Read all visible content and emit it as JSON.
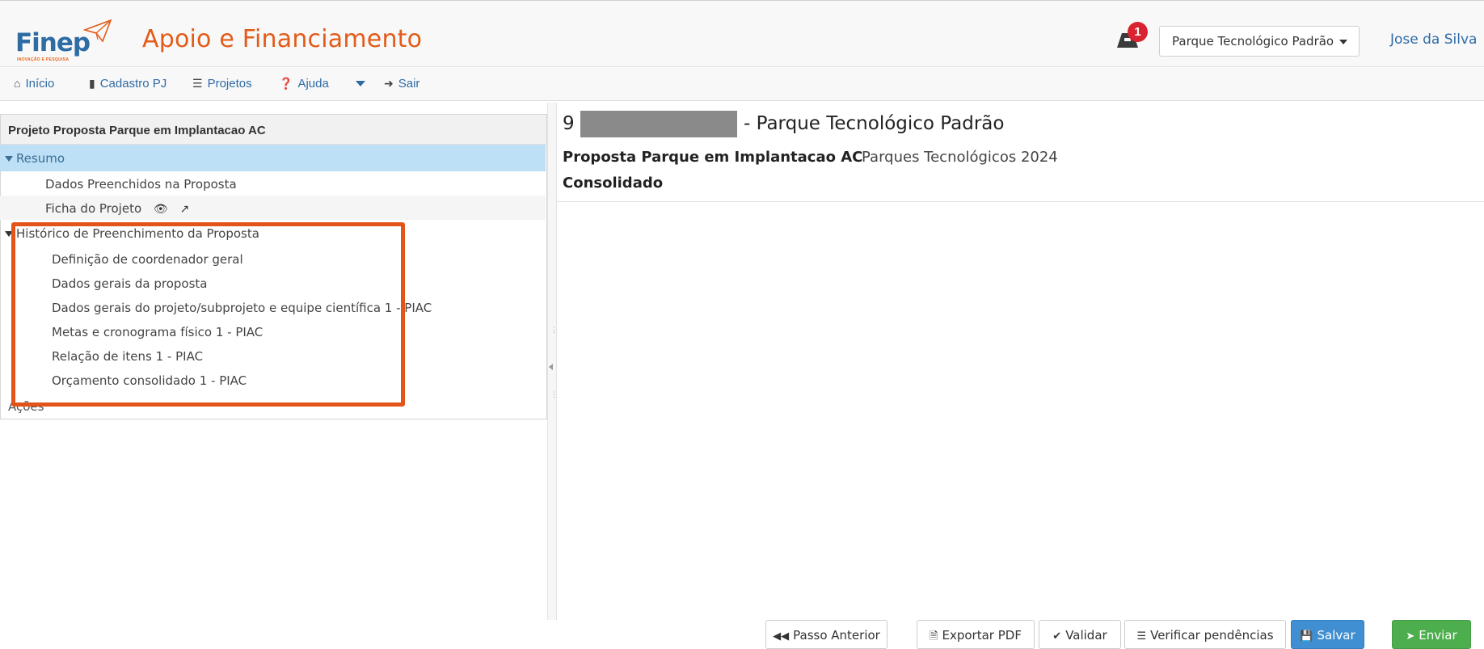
{
  "header": {
    "logo_text": "Finep",
    "logo_sub": "INOVAÇÃO E PESQUISA",
    "app_title": "Apoio e Financiamento",
    "notification_count": "1",
    "parque_selector": "Parque Tecnológico Padrão",
    "user_name": "Jose da Silva"
  },
  "navbar": {
    "items": [
      {
        "label": "Início",
        "icon": "home-icon"
      },
      {
        "label": "Cadastro PJ",
        "icon": "building-icon"
      },
      {
        "label": "Projetos",
        "icon": "list-icon"
      },
      {
        "label": "Ajuda",
        "icon": "question-circle-icon"
      },
      {
        "label": "Sair",
        "icon": "sign-out-icon"
      }
    ]
  },
  "left_panel": {
    "title": "Projeto Proposta Parque em Implantacao AC",
    "resumo": {
      "label": "Resumo",
      "items": [
        "Dados Preenchidos na Proposta",
        "Ficha do Projeto"
      ]
    },
    "historico": {
      "label": "Histórico de Preenchimento da Proposta",
      "items": [
        "Definição de coordenador geral",
        "Dados gerais da proposta",
        "Dados gerais do projeto/subprojeto e equipe científica 1 - PIAC",
        "Metas e cronograma físico 1 - PIAC",
        "Relação de itens 1 - PIAC",
        "Orçamento consolidado 1 - PIAC"
      ]
    },
    "acoes_label": "Ações"
  },
  "content": {
    "project_id_prefix": "9",
    "project_name": "- Parque Tecnológico Padrão",
    "proposta_title": "Proposta Parque em Implantacao AC",
    "chamada": "Parques Tecnológicos 2024",
    "section_title": "Consolidado"
  },
  "footer": {
    "buttons": [
      {
        "label": "Passo Anterior",
        "icon": "backward-icon"
      },
      {
        "label": "Exportar PDF",
        "icon": "file-pdf-icon"
      },
      {
        "label": "Validar",
        "icon": "check-circle-icon"
      },
      {
        "label": "Verificar pendências",
        "icon": "list-ol-icon"
      },
      {
        "label": "Salvar",
        "icon": "save-icon"
      },
      {
        "label": "Enviar",
        "icon": "send-icon"
      }
    ]
  },
  "colors": {
    "brand_orange": "#e35b18",
    "brand_blue": "#2e6da4",
    "selected_row": "#bde0f6",
    "highlight_box": "#e2541a",
    "primary_button": "#3f8fd2",
    "success_button": "#4cae4c",
    "badge_red": "#d9232e"
  }
}
